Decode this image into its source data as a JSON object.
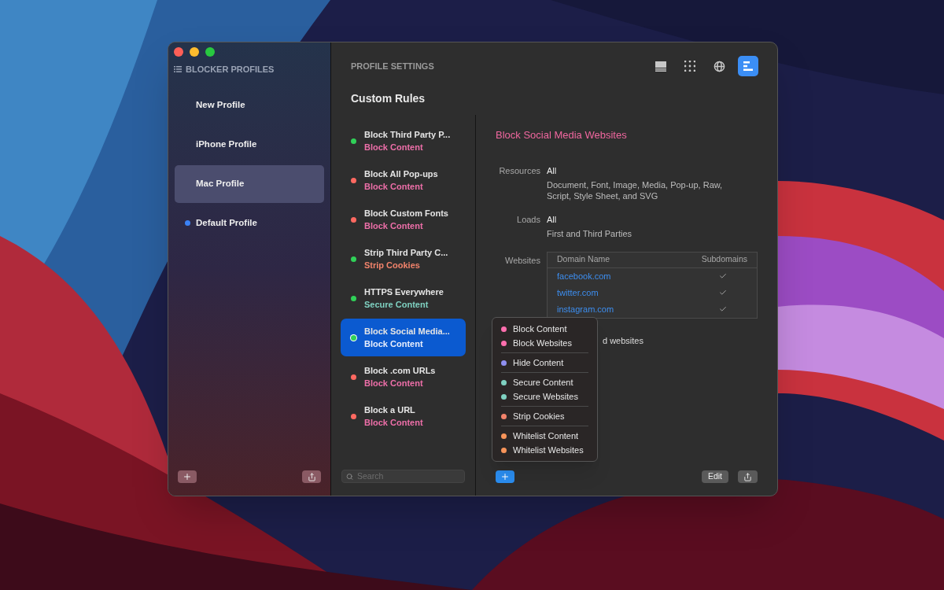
{
  "sidebar": {
    "title": "BLOCKER PROFILES",
    "profiles": [
      {
        "name": "New Profile",
        "selected": false,
        "default": false
      },
      {
        "name": "iPhone Profile",
        "selected": false,
        "default": false
      },
      {
        "name": "Mac Profile",
        "selected": true,
        "default": false
      },
      {
        "name": "Default Profile",
        "selected": false,
        "default": true
      }
    ]
  },
  "header": {
    "title": "PROFILE SETTINGS",
    "views": [
      {
        "kind": "list",
        "selected": false
      },
      {
        "kind": "grid",
        "selected": false
      },
      {
        "kind": "globe",
        "selected": false
      },
      {
        "kind": "rules",
        "selected": true
      }
    ]
  },
  "section_title": "Custom Rules",
  "rules": [
    {
      "title": "Block Third Party P...",
      "type": "Block Content",
      "kind": "block",
      "color": "#30d158",
      "selected": false
    },
    {
      "title": "Block All Pop-ups",
      "type": "Block Content",
      "kind": "block",
      "color": "#ff6961",
      "selected": false
    },
    {
      "title": "Block Custom Fonts",
      "type": "Block Content",
      "kind": "block",
      "color": "#ff6961",
      "selected": false
    },
    {
      "title": "Strip Third Party C...",
      "type": "Strip Cookies",
      "kind": "strip",
      "color": "#30d158",
      "selected": false
    },
    {
      "title": "HTTPS Everywhere",
      "type": "Secure Content",
      "kind": "secure",
      "color": "#30d158",
      "selected": false
    },
    {
      "title": "Block Social Media...",
      "type": "Block Content",
      "kind": "block",
      "color": "#30d158",
      "selected": true
    },
    {
      "title": "Block .com URLs",
      "type": "Block Content",
      "kind": "block",
      "color": "#ff6961",
      "selected": false
    },
    {
      "title": "Block a URL",
      "type": "Block Content",
      "kind": "block",
      "color": "#ff6961",
      "selected": false
    }
  ],
  "search": {
    "placeholder": "Search"
  },
  "detail": {
    "title": "Block Social Media Websites",
    "fields": [
      {
        "label": "Resources",
        "value": "All",
        "note": "Document, Font, Image, Media, Pop-up, Raw, Script, Style Sheet, and SVG"
      },
      {
        "label": "Loads",
        "value": "All",
        "note": "First and Third Parties"
      }
    ],
    "websites": {
      "label": "Websites",
      "columns": [
        "Domain Name",
        "Subdomains"
      ],
      "rows": [
        {
          "domain": "facebook.com",
          "subdomains": true
        },
        {
          "domain": "twitter.com",
          "subdomains": true
        },
        {
          "domain": "instagram.com",
          "subdomains": true
        }
      ]
    },
    "partial_text": "d websites",
    "edit_button": "Edit"
  },
  "menu": [
    [
      {
        "label": "Block Content",
        "color": "#ff6fae"
      },
      {
        "label": "Block Websites",
        "color": "#ff6fae"
      }
    ],
    [
      {
        "label": "Hide Content",
        "color": "#8f8ff0"
      }
    ],
    [
      {
        "label": "Secure Content",
        "color": "#7fd1c1"
      },
      {
        "label": "Secure Websites",
        "color": "#7fd1c1"
      }
    ],
    [
      {
        "label": "Strip Cookies",
        "color": "#f2836b"
      }
    ],
    [
      {
        "label": "Whitelist Content",
        "color": "#f7945a"
      },
      {
        "label": "Whitelist Websites",
        "color": "#f7945a"
      }
    ]
  ]
}
